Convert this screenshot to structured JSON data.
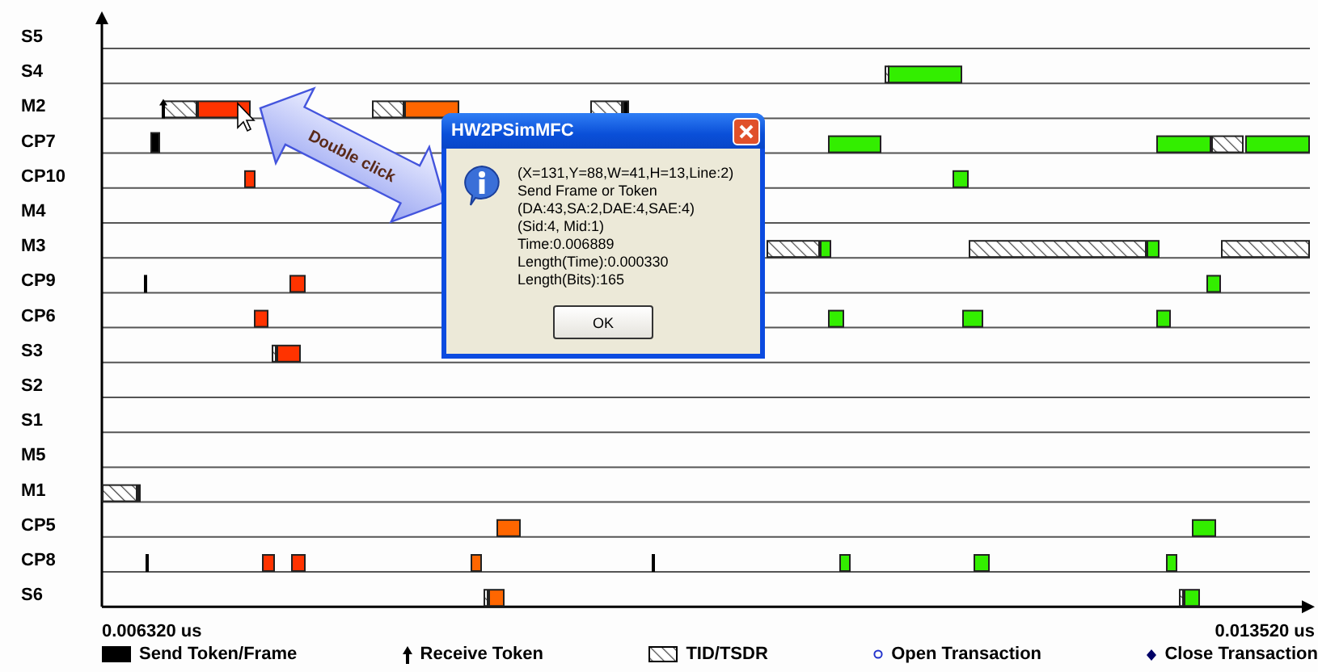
{
  "rows": [
    {
      "label": "S5"
    },
    {
      "label": "S4"
    },
    {
      "label": "M2"
    },
    {
      "label": "CP7"
    },
    {
      "label": "CP10"
    },
    {
      "label": "M4"
    },
    {
      "label": "M3"
    },
    {
      "label": "CP9"
    },
    {
      "label": "CP6"
    },
    {
      "label": "S3"
    },
    {
      "label": "S2"
    },
    {
      "label": "S1"
    },
    {
      "label": "M5"
    },
    {
      "label": "M1"
    },
    {
      "label": "CP5"
    },
    {
      "label": "CP8"
    },
    {
      "label": "S6"
    }
  ],
  "axis": {
    "start": "0.006320 us",
    "end": "0.013520 us"
  },
  "legend": [
    {
      "kind": "send",
      "label": "Send Token/Frame"
    },
    {
      "kind": "receive",
      "label": "Receive Token"
    },
    {
      "kind": "tid",
      "label": "TID/TSDR"
    },
    {
      "kind": "open",
      "label": "Open Transaction"
    },
    {
      "kind": "close",
      "label": "Close Transaction"
    }
  ],
  "callout": {
    "label": "Double click"
  },
  "dialog": {
    "title": "HW2PSimMFC",
    "lines": [
      "(X=131,Y=88,W=41,H=13,Line:2)",
      "Send Frame or Token",
      "(DA:43,SA:2,DAE:4,SAE:4)",
      "(Sid:4, Mid:1)",
      "Time:0.006889",
      "Length(Time):0.000330",
      "Length(Bits):165"
    ],
    "button": "OK"
  }
}
